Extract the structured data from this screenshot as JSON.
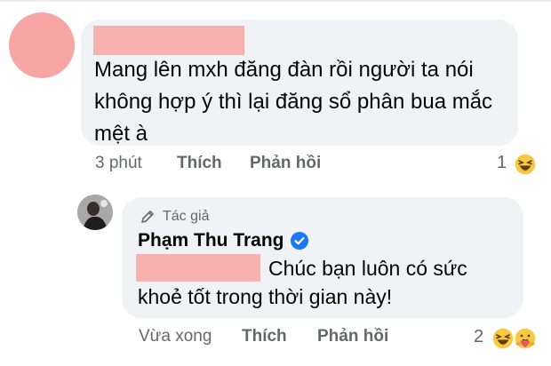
{
  "comment": {
    "body": "Mang lên mxh đăng đàn rồi người ta nói không hợp ý thì lại đăng sổ phân bua mắc mệt à",
    "time": "3 phút",
    "like_label": "Thích",
    "reply_label": "Phản hồi",
    "reaction_count": "1",
    "reaction_icons": [
      "haha-icon"
    ],
    "colors": {
      "redaction": "#f7b2b0",
      "avatar_placeholder": "#f7a6a5",
      "bubble": "#f0f2f5"
    }
  },
  "reply": {
    "author_badge": "Tác giả",
    "author_name": "Phạm Thu Trang",
    "verified_icon": "verified-check-icon",
    "body_line1": "Chúc bạn luôn có sức",
    "body_line2": "khoẻ tốt trong thời gian này!",
    "time": "Vừa xong",
    "like_label": "Thích",
    "reply_label": "Phản hồi",
    "reaction_count": "2",
    "reaction_icons": [
      "haha-icon",
      "care-icon"
    ],
    "colors": {
      "verified": "#1877f2",
      "secondary_text": "#65676b"
    }
  }
}
